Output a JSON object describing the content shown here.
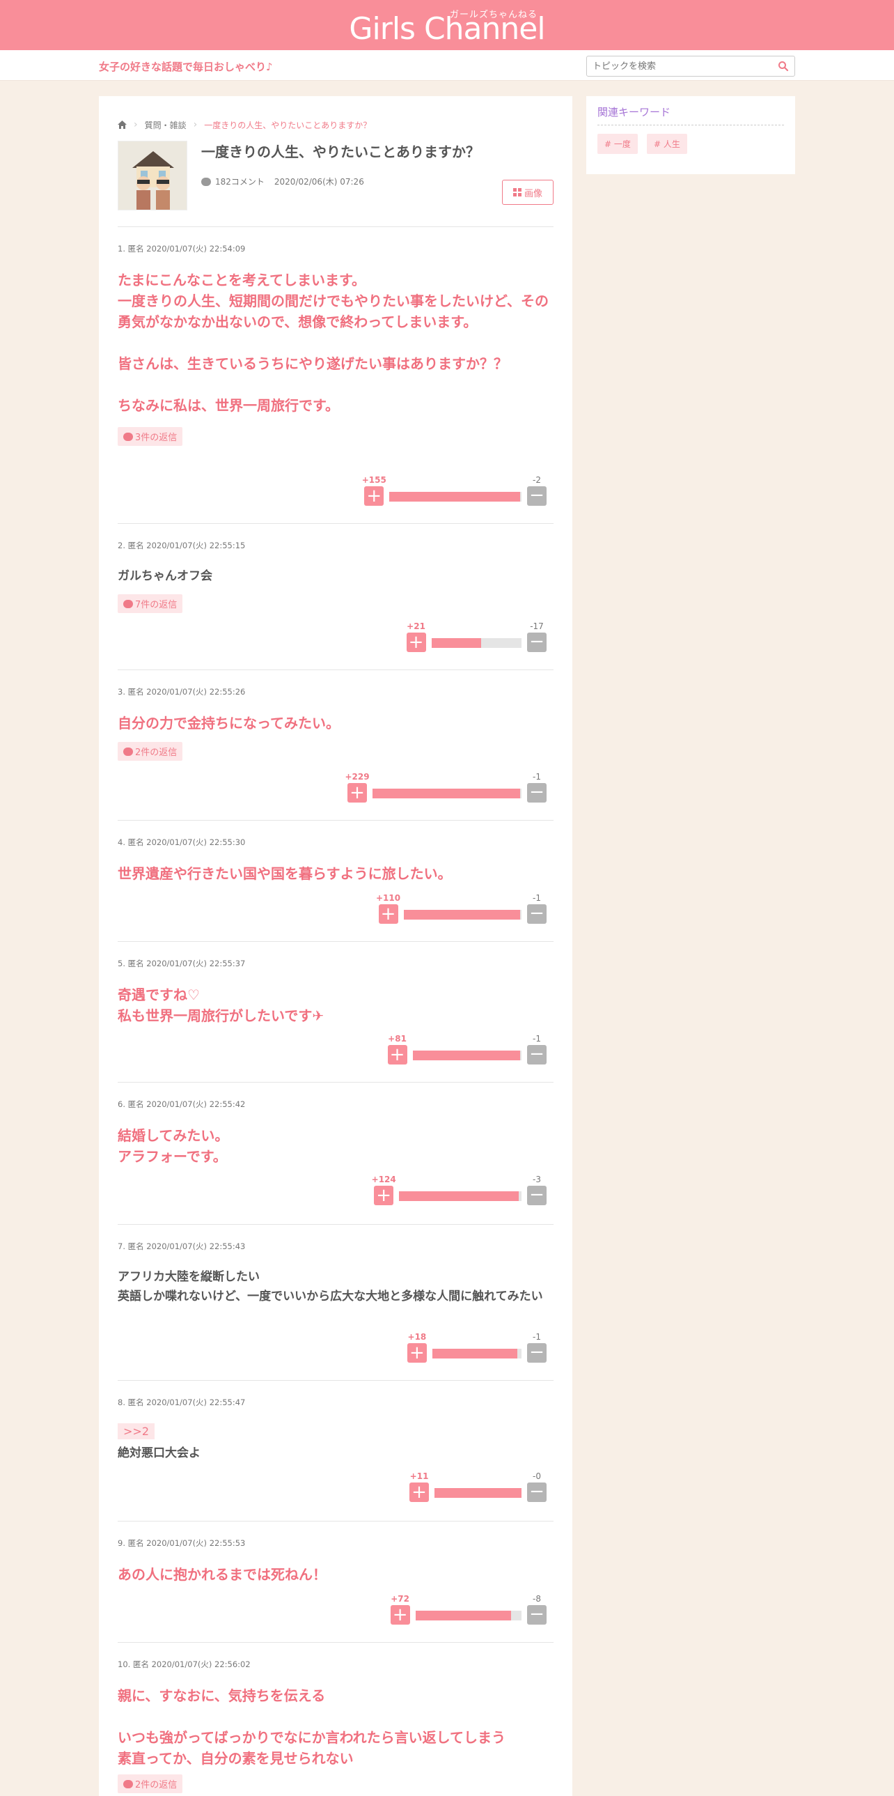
{
  "header": {
    "logo_kana": "ガールズちゃんねる",
    "logo_text": "Girls Channel",
    "tagline": "女子の好きな話題で毎日おしゃべり♪",
    "search_placeholder": "トピックを検索"
  },
  "sidebar": {
    "title": "関連キーワード",
    "keywords": [
      "# 一度",
      "# 人生"
    ]
  },
  "breadcrumb": {
    "home_icon": "home-icon",
    "category": "質問・雑談",
    "current": "一度きりの人生、やりたいことありますか？"
  },
  "topic": {
    "title": "一度きりの人生、やりたいことありますか？",
    "comment_count": "182コメント",
    "date": "2020/02/06(木) 07:26",
    "image_button": "画像"
  },
  "comments": [
    {
      "meta": "1. 匿名 2020/01/07(火) 22:54:09",
      "style": "red",
      "body": "たまにこんなことを考えてしまいます。\n一度きりの人生、短期間の間だけでもやりたい事をしたいけど、その勇気がなかなか出ないので、想像で終わってしまいます。\n\n皆さんは、生きているうちにやり遂げたい事はありますか？？\n\nちなみに私は、世界一周旅行です。\n",
      "replies": "3件の返信",
      "plus": "+155",
      "minus": "-2",
      "ratio": 0.99
    },
    {
      "meta": "2. 匿名 2020/01/07(火) 22:55:15",
      "style": "gray",
      "body": "ガルちゃんオフ会",
      "replies": "7件の返信",
      "plus": "+21",
      "minus": "-17",
      "ratio": 0.55
    },
    {
      "meta": "3. 匿名 2020/01/07(火) 22:55:26",
      "style": "red",
      "body": "自分の力で金持ちになってみたい。",
      "replies": "2件の返信",
      "plus": "+229",
      "minus": "-1",
      "ratio": 0.99
    },
    {
      "meta": "4. 匿名 2020/01/07(火) 22:55:30",
      "style": "red",
      "body": "世界遺産や行きたい国や国を暮らすように旅したい。",
      "plus": "+110",
      "minus": "-1",
      "ratio": 0.99
    },
    {
      "meta": "5. 匿名 2020/01/07(火) 22:55:37",
      "style": "red",
      "body": "奇遇ですね♡\n私も世界一周旅行がしたいです✈",
      "plus": "+81",
      "minus": "-1",
      "ratio": 0.99
    },
    {
      "meta": "6. 匿名 2020/01/07(火) 22:55:42",
      "style": "red",
      "body": "結婚してみたい。\nアラフォーです。",
      "plus": "+124",
      "minus": "-3",
      "ratio": 0.98
    },
    {
      "meta": "7. 匿名 2020/01/07(火) 22:55:43",
      "style": "gray",
      "body": "アフリカ大陸を縦断したい\n英語しか喋れないけど、一度でいいから広大な大地と多様な人間に触れてみたい",
      "plus": "+18",
      "minus": "-1",
      "ratio": 0.95
    },
    {
      "meta": "8. 匿名 2020/01/07(火) 22:55:47",
      "style": "gray",
      "quote": ">>2",
      "body": "絶対悪口大会よ",
      "plus": "+11",
      "minus": "-0",
      "ratio": 1.0
    },
    {
      "meta": "9. 匿名 2020/01/07(火) 22:55:53",
      "style": "red",
      "body": "あの人に抱かれるまでは死ねん！",
      "plus": "+72",
      "minus": "-8",
      "ratio": 0.9
    },
    {
      "meta": "10. 匿名 2020/01/07(火) 22:56:02",
      "style": "red",
      "body": "親に、すなおに、気持ちを伝える\n\nいつも強がってばっかりでなにか言われたら言い返してしまう\n素直ってか、自分の素を見せられない",
      "replies": "2件の返信"
    }
  ]
}
